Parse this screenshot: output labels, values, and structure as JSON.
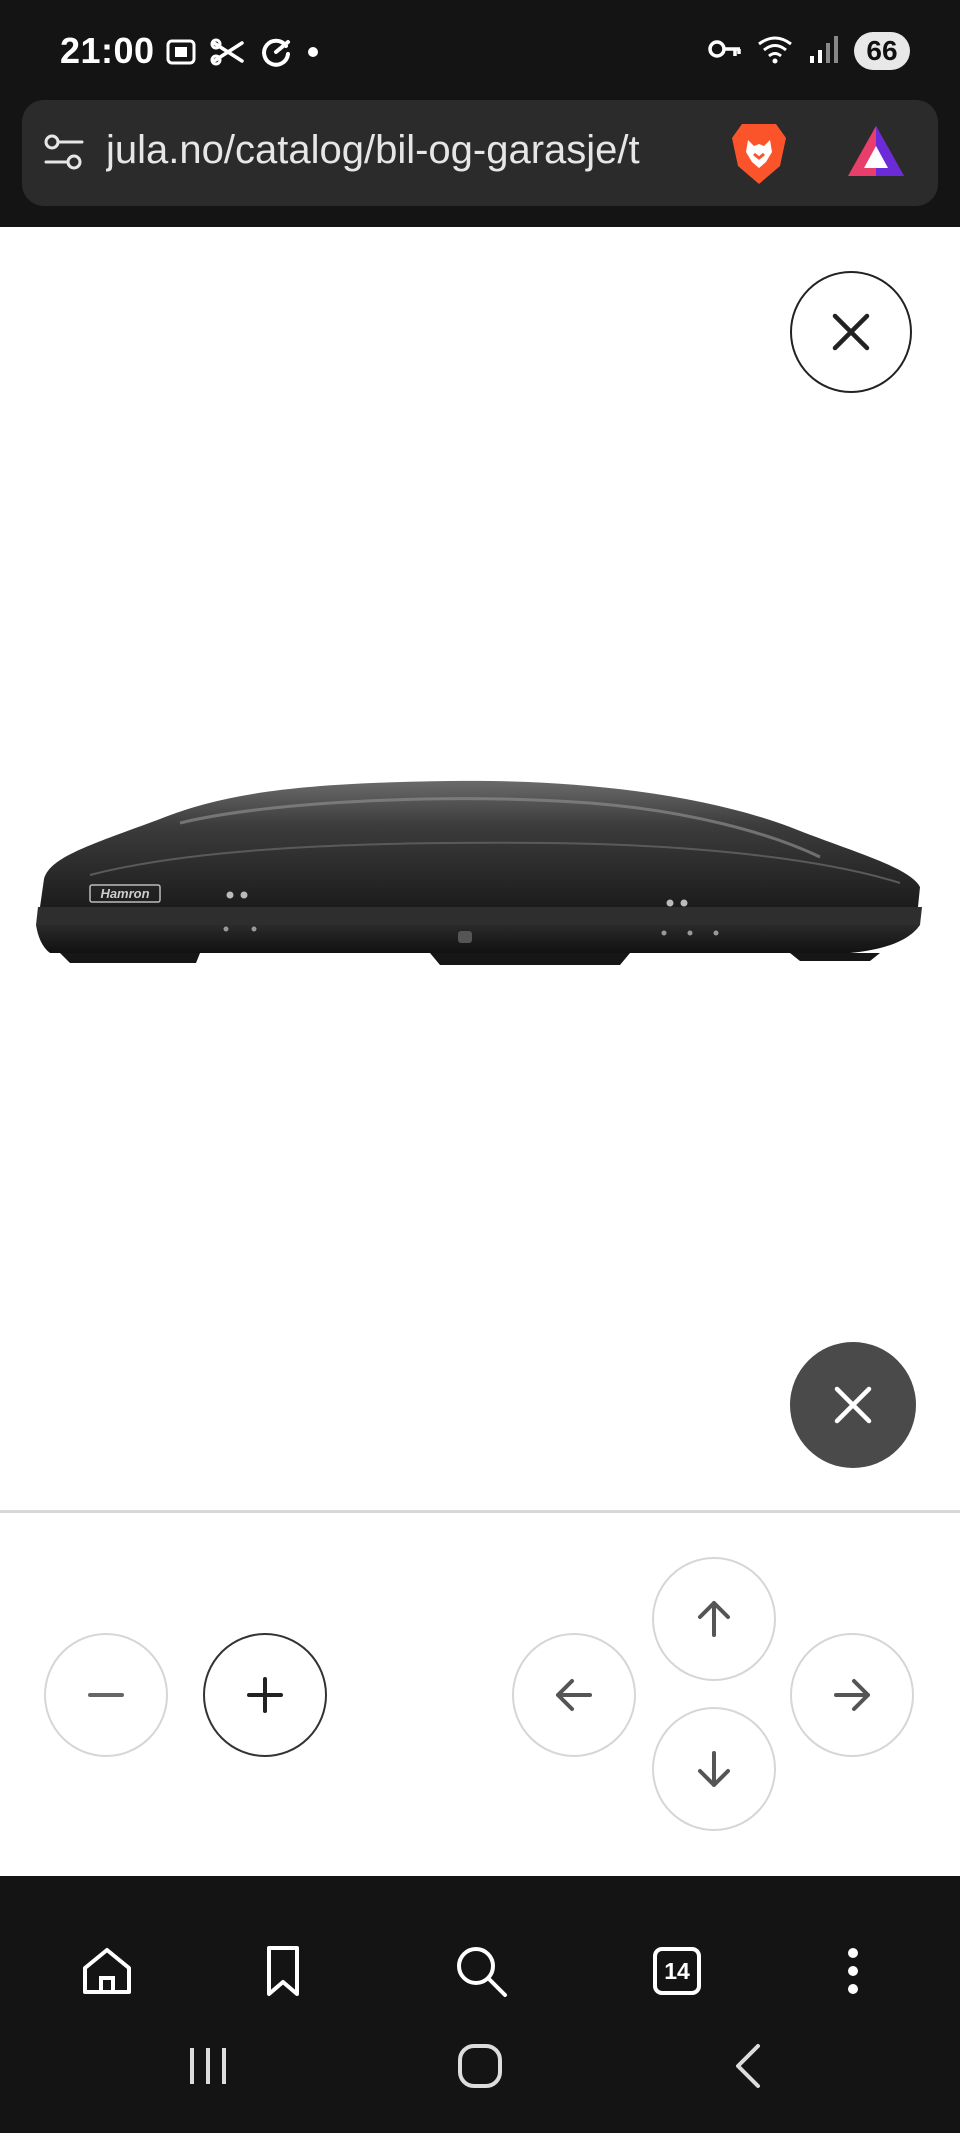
{
  "status_bar": {
    "time": "21:00",
    "battery": "66"
  },
  "address_bar": {
    "url": "jula.no/catalog/bil-og-garasje/t"
  },
  "product": {
    "brand_mark": "Hamron"
  },
  "tab_bar": {
    "tab_count": "14"
  }
}
